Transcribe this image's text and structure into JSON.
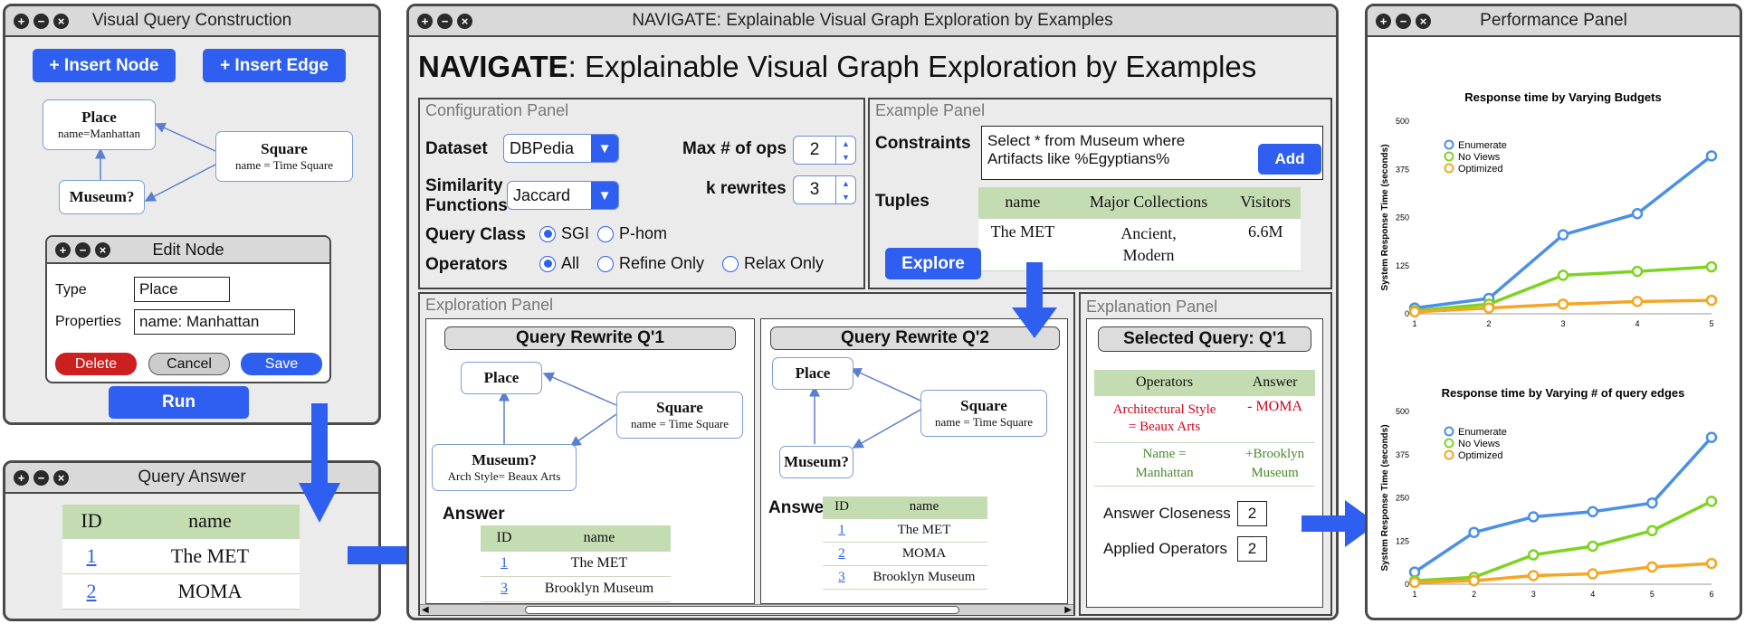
{
  "colors": {
    "accent": "#2f5ff0",
    "enumerate": "#4a90e8",
    "noviews": "#7ed321",
    "optimized": "#f5a623",
    "delete": "#cc1f1f",
    "table_header": "#c4dcb2",
    "remove_red": "#d0021b",
    "add_green": "#4a8a2a"
  },
  "vqc": {
    "title": "Visual Query Construction",
    "insert_node": "+ Insert Node",
    "insert_edge": "+ Insert Edge",
    "node_place": {
      "name": "Place",
      "prop": "name=Manhattan"
    },
    "node_square": {
      "name": "Square",
      "prop": "name = Time Square"
    },
    "node_museum": {
      "name": "Museum?"
    },
    "edit": {
      "title": "Edit Node",
      "type_label": "Type",
      "type_value": "Place",
      "props_label": "Properties",
      "props_value": "name: Manhattan",
      "delete": "Delete",
      "cancel": "Cancel",
      "save": "Save"
    },
    "run": "Run"
  },
  "qa": {
    "title": "Query Answer",
    "headers": [
      "ID",
      "name"
    ],
    "rows": [
      {
        "id": "1",
        "name": "The MET"
      },
      {
        "id": "2",
        "name": "MOMA"
      }
    ]
  },
  "main": {
    "window_title": "NAVIGATE: Explainable Visual Graph Exploration by Examples",
    "heading_bold": "NAVIGATE",
    "heading_rest": ": Explainable Visual Graph Exploration by Examples",
    "config": {
      "label": "Configuration Panel",
      "dataset_label": "Dataset",
      "dataset_value": "DBPedia",
      "sim_label_1": "Similarity",
      "sim_label_2": "Functions",
      "sim_value": "Jaccard",
      "maxops_label": "Max # of ops",
      "maxops_value": "2",
      "krew_label": "k rewrites",
      "krew_value": "3",
      "qclass_label": "Query Class",
      "qclass_opts": [
        "SGI",
        "P-hom"
      ],
      "operators_label": "Operators",
      "operator_opts": [
        "All",
        "Refine Only",
        "Relax Only"
      ]
    },
    "example": {
      "label": "Example Panel",
      "constraints_label": "Constraints",
      "constraint_line1": "Select * from Museum where",
      "constraint_line2": "Artifacts like %Egyptians%",
      "add": "Add",
      "tuples_label": "Tuples",
      "headers": [
        "name",
        "Major Collections",
        "Visitors"
      ],
      "row": {
        "name": "The MET",
        "coll1": "Ancient,",
        "coll2": "Modern",
        "visitors": "6.6M"
      }
    },
    "explore": "Explore",
    "exploration": {
      "label": "Exploration Panel",
      "q1": {
        "title": "Query Rewrite Q'1",
        "place": "Place",
        "square": "Square",
        "square_prop": "name = Time Square",
        "museum": "Museum?",
        "museum_prop": "Arch Style= Beaux Arts",
        "answer_label": "Answer",
        "headers": [
          "ID",
          "name"
        ],
        "rows": [
          {
            "id": "1",
            "name": "The MET"
          },
          {
            "id": "3",
            "name": "Brooklyn Museum"
          }
        ]
      },
      "q2": {
        "title": "Query Rewrite Q'2",
        "place": "Place",
        "square": "Square",
        "square_prop": "name = Time Square",
        "museum": "Museum?",
        "answer_label": "Answer",
        "headers": [
          "ID",
          "name"
        ],
        "rows": [
          {
            "id": "1",
            "name": "The MET"
          },
          {
            "id": "2",
            "name": "MOMA"
          },
          {
            "id": "3",
            "name": "Brooklyn Museum"
          }
        ]
      }
    },
    "explanation": {
      "label": "Explanation Panel",
      "selected": "Selected Query: Q'1",
      "headers": [
        "Operators",
        "Answer"
      ],
      "r1_op1": "Architectural Style",
      "r1_op2": "= Beaux Arts",
      "r1_ans": "- MOMA",
      "r2_op1": "Name =",
      "r2_op2": "Manhattan",
      "r2_ans1": "+Brooklyn",
      "r2_ans2": "Museum",
      "closeness_label": "Answer Closeness",
      "closeness_value": "2",
      "applied_label": "Applied Operators",
      "applied_value": "2"
    }
  },
  "perf": {
    "title": "Performance Panel"
  },
  "chart_data": [
    {
      "type": "line",
      "title": "Response time by Varying Budgets",
      "ylabel": "System Response Time (seconds)",
      "x": [
        1,
        2,
        3,
        4,
        5
      ],
      "yticks": [
        0,
        125,
        250,
        375,
        500
      ],
      "ylim": [
        0,
        500
      ],
      "legend": "top-left",
      "series": [
        {
          "name": "Enumerate",
          "values": [
            15,
            40,
            205,
            260,
            410
          ]
        },
        {
          "name": "No Views",
          "values": [
            8,
            25,
            100,
            110,
            122
          ]
        },
        {
          "name": "Optimized",
          "values": [
            5,
            15,
            25,
            32,
            35
          ]
        }
      ]
    },
    {
      "type": "line",
      "title": "Response time by Varying # of query edges",
      "ylabel": "System Response Time (seconds)",
      "x": [
        1,
        2,
        3,
        4,
        5,
        6
      ],
      "yticks": [
        0,
        125,
        250,
        375,
        500
      ],
      "ylim": [
        0,
        500
      ],
      "legend": "top-left",
      "series": [
        {
          "name": "Enumerate",
          "values": [
            35,
            150,
            195,
            210,
            235,
            425
          ]
        },
        {
          "name": "No Views",
          "values": [
            10,
            20,
            85,
            110,
            155,
            240
          ]
        },
        {
          "name": "Optimized",
          "values": [
            5,
            10,
            25,
            30,
            50,
            60
          ]
        }
      ]
    }
  ]
}
